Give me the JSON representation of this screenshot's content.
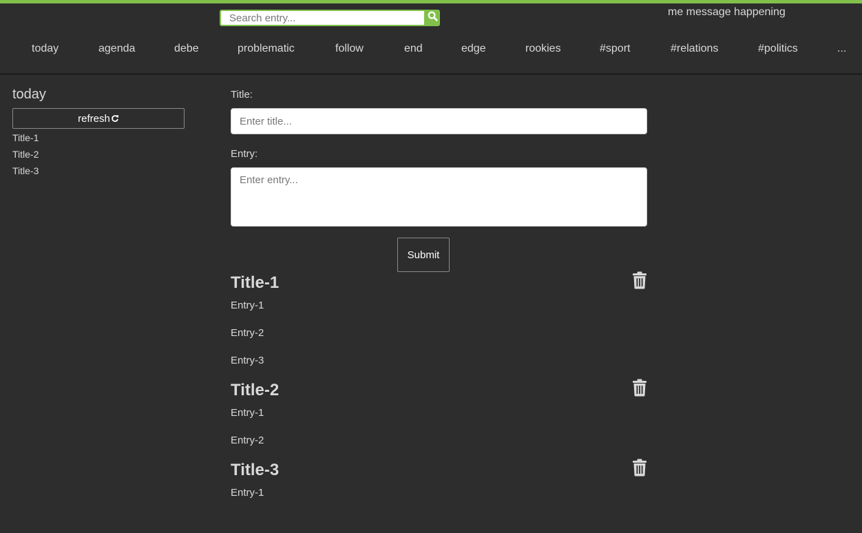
{
  "search": {
    "placeholder": "Search entry...",
    "icon": "search-icon"
  },
  "user_message": "me message happening",
  "nav": {
    "items": [
      "today",
      "agenda",
      "debe",
      "problematic",
      "follow",
      "end",
      "edge",
      "rookies",
      "#sport",
      "#relations",
      "#politics",
      "..."
    ]
  },
  "sidebar": {
    "heading": "today",
    "refresh_label": "refresh",
    "refresh_icon": "refresh-icon",
    "titles": [
      "Title-1",
      "Title-2",
      "Title-3"
    ]
  },
  "form": {
    "title_label": "Title:",
    "title_placeholder": "Enter title...",
    "entry_label": "Entry:",
    "entry_placeholder": "Enter entry...",
    "submit_label": "Submit"
  },
  "posts": [
    {
      "title": "Title-1",
      "entries": [
        "Entry-1",
        "Entry-2",
        "Entry-3"
      ]
    },
    {
      "title": "Title-2",
      "entries": [
        "Entry-1",
        "Entry-2"
      ]
    },
    {
      "title": "Title-3",
      "entries": [
        "Entry-1"
      ]
    }
  ],
  "colors": {
    "accent": "#81c14b",
    "background": "#2d2d2d",
    "text": "#d9d9d9"
  }
}
